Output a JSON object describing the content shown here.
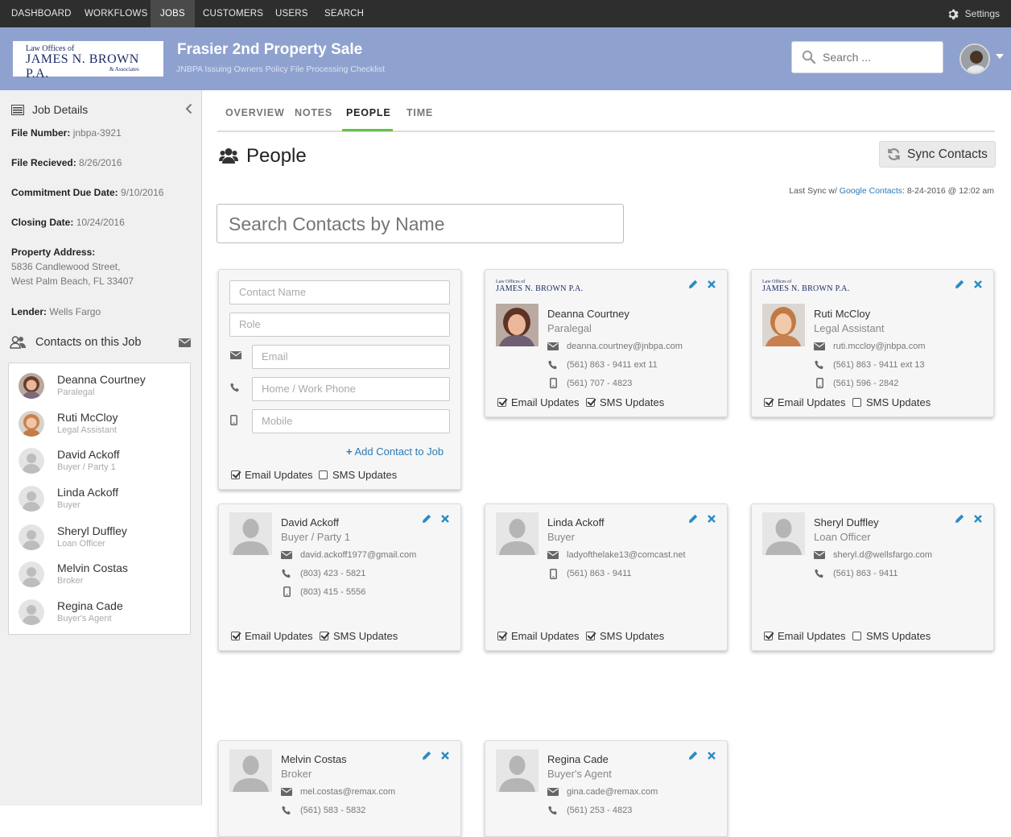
{
  "nav": {
    "items": [
      "DASHBOARD",
      "WORKFLOWS",
      "JOBS",
      "CUSTOMERS",
      "USERS",
      "SEARCH"
    ],
    "active": "JOBS",
    "settings_label": "Settings"
  },
  "logo": {
    "line1": "Law Offices of",
    "line2": "JAMES N. BROWN P.A.",
    "line3": "& Associates"
  },
  "header": {
    "title": "Frasier 2nd Property Sale",
    "subtitle": "JNBPA Issuing Owners Policy File Processing Checklist",
    "search_placeholder": "Search ..."
  },
  "sidebar": {
    "title": "Job Details",
    "details": [
      {
        "label": "File Number:",
        "value": "jnbpa-3921"
      },
      {
        "label": "File Recieved:",
        "value": "8/26/2016"
      },
      {
        "label": "Commitment Due Date:",
        "value": "9/10/2016"
      },
      {
        "label": "Closing Date:",
        "value": "10/24/2016"
      }
    ],
    "address_label": "Property Address:",
    "address_line1": "5836 Candlewood Street,",
    "address_line2": "West Palm Beach, FL 33407",
    "lender_label": "Lender:",
    "lender_value": "Wells Fargo",
    "contacts_title": "Contacts on this Job",
    "contacts": [
      {
        "name": "Deanna Courtney",
        "role": "Paralegal"
      },
      {
        "name": "Ruti McCloy",
        "role": "Legal Assistant"
      },
      {
        "name": "David Ackoff",
        "role": "Buyer / Party 1"
      },
      {
        "name": "Linda Ackoff",
        "role": "Buyer"
      },
      {
        "name": "Sheryl Duffley",
        "role": "Loan Officer"
      },
      {
        "name": "Melvin Costas",
        "role": "Broker"
      },
      {
        "name": "Regina Cade",
        "role": "Buyer's Agent"
      }
    ]
  },
  "tabs": [
    "OVERVIEW",
    "NOTES",
    "PEOPLE",
    "TIME"
  ],
  "active_tab": "PEOPLE",
  "page": {
    "title": "People",
    "sync_label": "Sync Contacts",
    "last_sync_prefix": "Last Sync w/ ",
    "last_sync_link": "Google Contacts",
    "last_sync_suffix": ": 8-24-2016 @ 12:02 am",
    "search_placeholder": "Search Contacts by Name"
  },
  "new_contact_form": {
    "name_placeholder": "Contact Name",
    "role_placeholder": "Role",
    "email_placeholder": "Email",
    "phone_placeholder": "Home / Work Phone",
    "mobile_placeholder": "Mobile",
    "add_label": "Add Contact to Job",
    "email_updates_label": "Email Updates",
    "sms_updates_label": "SMS Updates",
    "email_checked": true,
    "sms_checked": false
  },
  "cards": [
    {
      "name": "Deanna Courtney",
      "role": "Paralegal",
      "email": "deanna.courtney@jnbpa.com",
      "phone": "(561) 863 - 9411 ext 11",
      "mobile": "(561) 707 - 4823",
      "email_updates": true,
      "sms_updates": true,
      "firm_logo": true
    },
    {
      "name": "Ruti McCloy",
      "role": "Legal Assistant",
      "email": "ruti.mccloy@jnbpa.com",
      "phone": "(561) 863 - 9411 ext 13",
      "mobile": "(561) 596 - 2842",
      "email_updates": true,
      "sms_updates": false,
      "firm_logo": true
    },
    {
      "name": "David Ackoff",
      "role": "Buyer / Party 1",
      "email": "david.ackoff1977@gmail.com",
      "phone": "(803) 423 - 5821",
      "mobile": "(803) 415 - 5556",
      "email_updates": true,
      "sms_updates": true
    },
    {
      "name": "Linda Ackoff",
      "role": "Buyer",
      "email": "ladyofthelake13@comcast.net",
      "mobile": "(561) 863 - 9411",
      "email_updates": true,
      "sms_updates": true
    },
    {
      "name": "Sheryl Duffley",
      "role": "Loan Officer",
      "email": "sheryl.d@wellsfargo.com",
      "phone": "(561) 863 - 9411",
      "email_updates": true,
      "sms_updates": false
    },
    {
      "name": "Melvin Costas",
      "role": "Broker",
      "email": "mel.costas@remax.com",
      "phone": "(561) 583 - 5832"
    },
    {
      "name": "Regina Cade",
      "role": "Buyer's Agent",
      "email": "gina.cade@remax.com",
      "phone": "(561) 253 - 4823"
    }
  ],
  "checkbox_labels": {
    "email": "Email Updates",
    "sms": "SMS Updates"
  },
  "colors": {
    "nav_bg": "#2e2e2e",
    "header_bg": "#8fa2cf",
    "accent_blue": "#2a7ab8",
    "tab_underline": "#6abf4b"
  }
}
